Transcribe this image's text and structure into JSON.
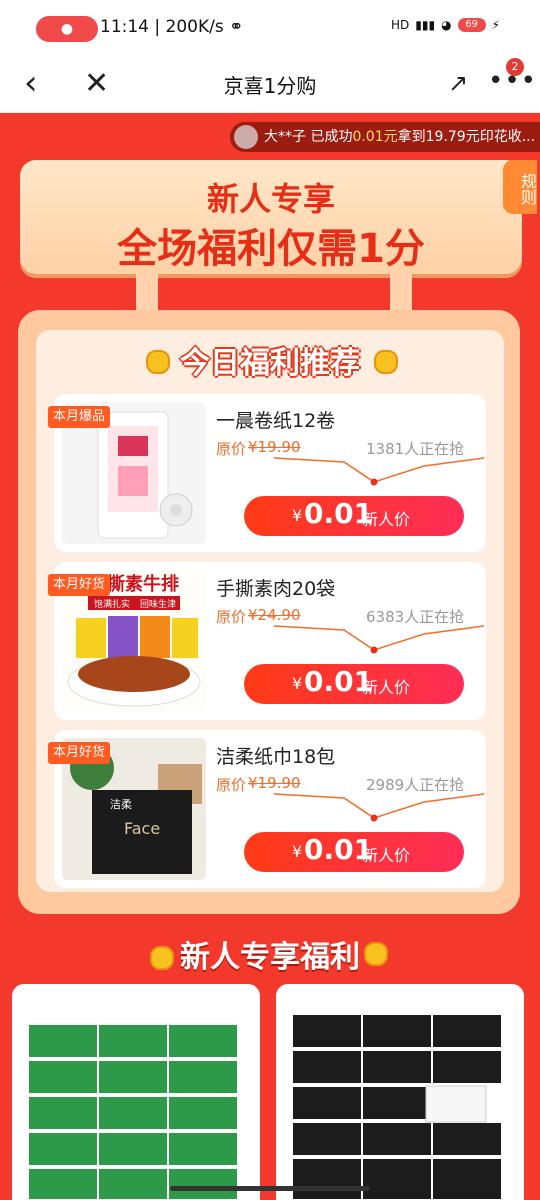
{
  "status_bar": {
    "time": "11:14",
    "speed": "200K/s",
    "network": "HD",
    "battery": "69"
  },
  "navbar": {
    "title": "京喜1分购",
    "more_badge": "2"
  },
  "marquee": {
    "user": "大**子",
    "msg_a": " 已成功",
    "amount": "0.01元",
    "msg_b": "拿到19.79元印花收..."
  },
  "banner": {
    "line1": "新人专享",
    "line2": "全场福利仅需1分",
    "rules": "规则"
  },
  "board": {
    "title": "今日福利推荐"
  },
  "products": [
    {
      "tag": "本月爆品",
      "name": "一晨卷纸12卷",
      "orig_label": "原价",
      "orig_price": "¥19.90",
      "grabbing": "1381人正在抢",
      "price_symbol": "¥",
      "price": "0.01",
      "price_label": "新人价"
    },
    {
      "tag": "本月好货",
      "name": "手撕素肉20袋",
      "orig_label": "原价",
      "orig_price": "¥24.90",
      "grabbing": "6383人正在抢",
      "price_symbol": "¥",
      "price": "0.01",
      "price_label": "新人价",
      "img_text_1": "手撕素牛排",
      "img_text_2": "饱满扎实",
      "img_text_3": "回味生津"
    },
    {
      "tag": "本月好货",
      "name": "洁柔纸巾18包",
      "orig_label": "原价",
      "orig_price": "¥19.90",
      "grabbing": "2989人正在抢",
      "price_symbol": "¥",
      "price": "0.01",
      "price_label": "新人价",
      "img_text_1": "洁柔",
      "img_text_2": "Face"
    }
  ],
  "section2": {
    "title": "新人专享福利"
  },
  "colors": {
    "accent": "#f3382c",
    "cta": "#ff3b16",
    "orange": "#f56c28"
  }
}
